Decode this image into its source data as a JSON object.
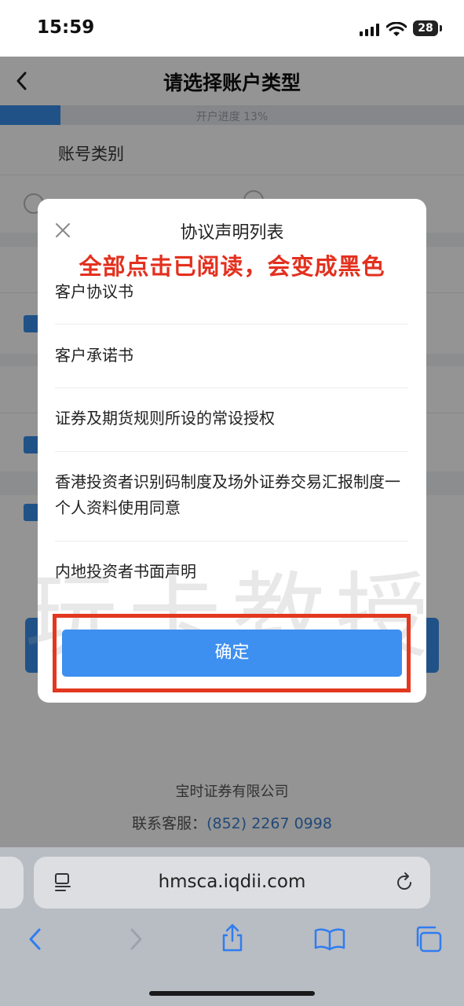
{
  "status_bar": {
    "time": "15:59",
    "battery": "28"
  },
  "page": {
    "title": "请选择账户类型",
    "progress_label": "开户进度 13%",
    "progress_fraction": 0.13,
    "section_label": "账号类别",
    "company": "宝时证券有限公司",
    "hotline_label": "联系客服：",
    "hotline_number": "(852) 2267 0998"
  },
  "modal": {
    "title": "协议声明列表",
    "hint": "全部点击已阅读，会变成黑色",
    "items": [
      "客户协议书",
      "客户承诺书",
      "证券及期货规则所设的常设授权",
      "香港投资者识别码制度及场外证券交易汇报制度一个人资料使用同意",
      "内地投资者书面声明"
    ],
    "confirm_label": "确定"
  },
  "watermark": "玩卡教授",
  "browser": {
    "url": "hmsca.iqdii.com"
  },
  "colors": {
    "accent": "#3a8ee8",
    "hint_red": "#e3301e"
  },
  "icons": [
    "back-chevron-icon",
    "signal-icon",
    "wifi-icon",
    "close-icon",
    "reader-icon",
    "reload-icon",
    "browser-back-icon",
    "browser-forward-icon",
    "share-icon",
    "bookmarks-icon",
    "tabs-icon"
  ]
}
